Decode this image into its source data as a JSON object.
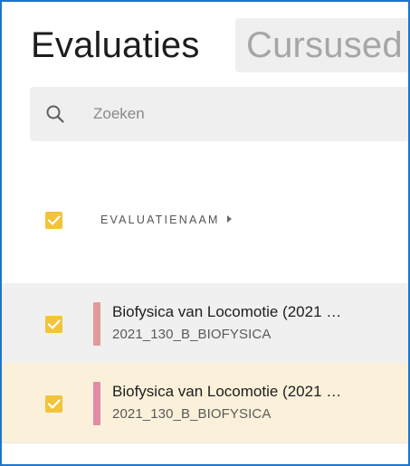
{
  "tabs": {
    "active_label": "Evaluaties",
    "inactive_label": "Cursused"
  },
  "search": {
    "placeholder": "Zoeken",
    "value": "",
    "icon": "search-icon"
  },
  "table": {
    "select_all_checked": true,
    "column_header": "EVALUATIENAAM",
    "sort_icon": "caret-right-icon",
    "rows": [
      {
        "title": "Biofysica van Locomotie (2021 …",
        "code": "2021_130_B_BIOFYSICA",
        "checked": true,
        "color": "#e39a99",
        "background": "#f0f0f0"
      },
      {
        "title": "Biofysica van Locomotie (2021 …",
        "code": "2021_130_B_BIOFYSICA",
        "checked": true,
        "color": "#e48aa5",
        "background": "#fbf1da"
      }
    ]
  },
  "colors": {
    "checkbox": "#f3c33a",
    "frame_border": "#1f74c9",
    "selected_row": "#fbf1da"
  }
}
